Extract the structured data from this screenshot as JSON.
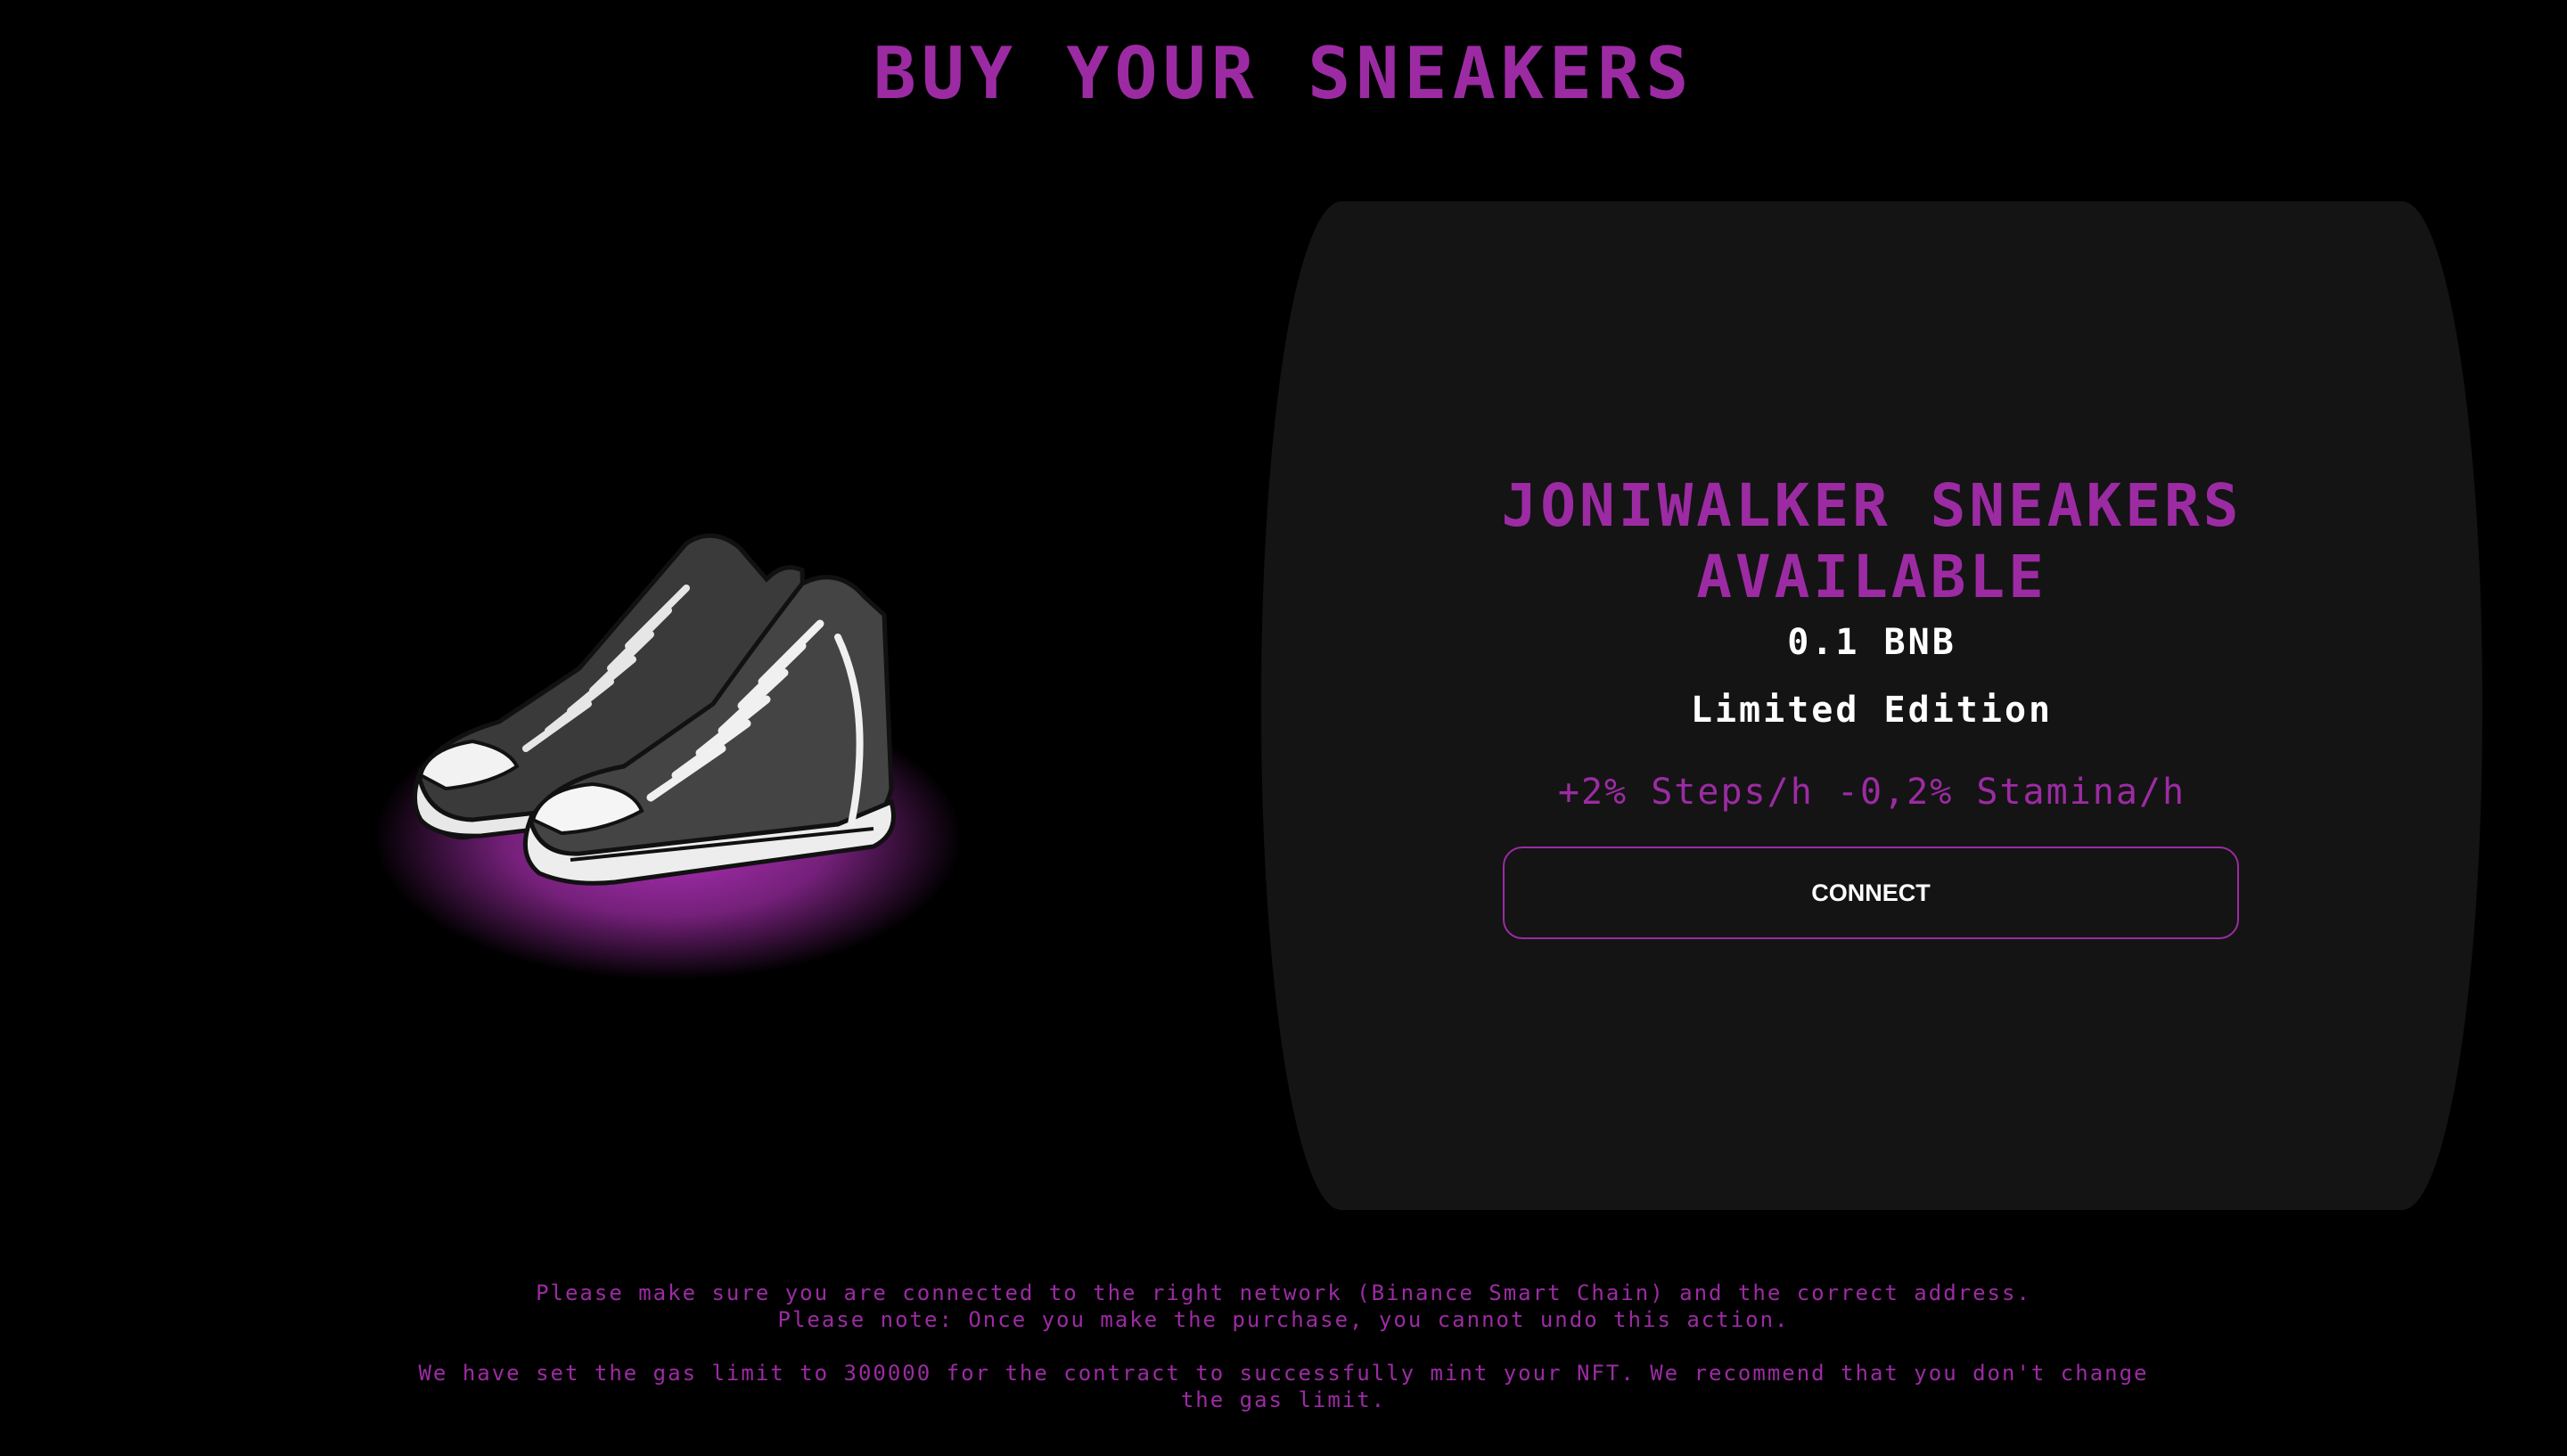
{
  "page": {
    "title": "BUY YOUR SNEAKERS"
  },
  "product": {
    "image_icon": "sneakers-image",
    "title_line1": "JONIWALKER SNEAKERS",
    "title_line2": "AVAILABLE",
    "price": "0.1 BNB",
    "edition": "Limited Edition",
    "stats": "+2% Steps/h -0,2% Stamina/h",
    "connect_label": "CONNECT"
  },
  "footer": {
    "line1": "Please make sure you are connected to the right network (Binance Smart Chain) and the correct address.",
    "line2": "Please note: Once you make the purchase, you cannot undo this action.",
    "line3": "We have set the gas limit to 300000 for the contract to successfully mint your NFT. We recommend that you don't change the gas limit."
  },
  "colors": {
    "accent": "#9c2ba3",
    "background": "#000000",
    "card": "#141414",
    "text": "#ffffff"
  }
}
